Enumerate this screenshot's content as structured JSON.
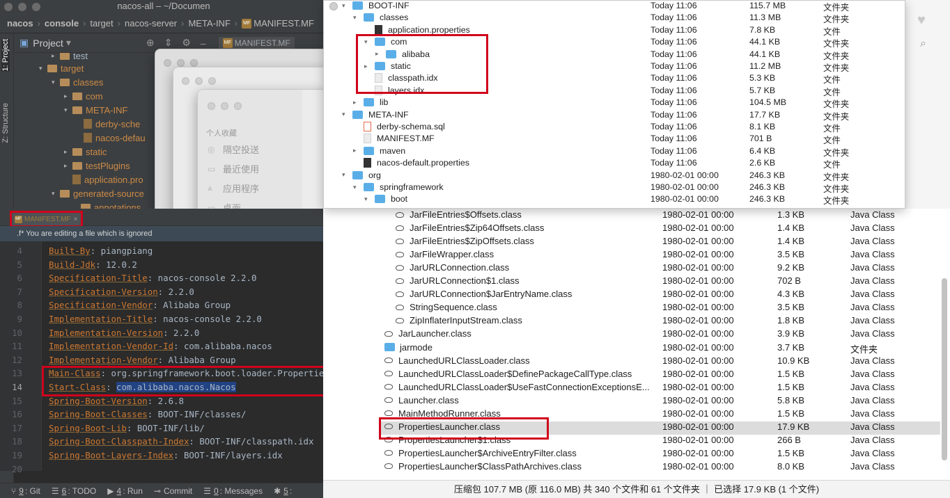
{
  "ide": {
    "window_title": "nacos-all – ~/Documen",
    "breadcrumbs": [
      "nacos",
      "console",
      "target",
      "nacos-server",
      "META-INF",
      "MANIFEST.MF"
    ],
    "breadcrumb_badge": "MF",
    "project_label": "Project",
    "top_editor_tab": "MANIFEST.MF",
    "side_tabs": [
      "1: Project",
      "Z: Structure"
    ],
    "tree": [
      {
        "label": "test",
        "indent": 3,
        "type": "folder",
        "arrow": "▸"
      },
      {
        "label": "target",
        "indent": 2,
        "type": "folder",
        "arrow": "▾"
      },
      {
        "label": "classes",
        "indent": 3,
        "type": "folder",
        "arrow": "▾"
      },
      {
        "label": "com",
        "indent": 4,
        "type": "folder",
        "arrow": "▸"
      },
      {
        "label": "META-INF",
        "indent": 4,
        "type": "folder",
        "arrow": "▾"
      },
      {
        "label": "derby-sche",
        "indent": 5,
        "type": "file",
        "arrow": ""
      },
      {
        "label": "nacos-defau",
        "indent": 5,
        "type": "file",
        "arrow": ""
      },
      {
        "label": "static",
        "indent": 4,
        "type": "folder",
        "arrow": "▸"
      },
      {
        "label": "testPlugins",
        "indent": 4,
        "type": "folder",
        "arrow": "▸"
      },
      {
        "label": "application.pro",
        "indent": 4,
        "type": "file",
        "arrow": ""
      },
      {
        "label": "generated-source",
        "indent": 3,
        "type": "folder",
        "arrow": "▾"
      },
      {
        "label": "annotations",
        "indent": 4,
        "type": "folder",
        "arrow": ""
      }
    ],
    "editor_tab": "MANIFEST.MF",
    "editor_banner": ".f* You are editing a file which is ignored",
    "code_lines": [
      {
        "n": "4",
        "key": "Built-By",
        "val": " piangpiang"
      },
      {
        "n": "5",
        "key": "Build-Jdk",
        "val": " 12.0.2"
      },
      {
        "n": "6",
        "key": "Specification-Title",
        "val": " nacos-console 2.2.0"
      },
      {
        "n": "7",
        "key": "Specification-Version",
        "val": " 2.2.0"
      },
      {
        "n": "8",
        "key": "Specification-Vendor",
        "val": " Alibaba Group"
      },
      {
        "n": "9",
        "key": "Implementation-Title",
        "val": " nacos-console 2.2.0"
      },
      {
        "n": "10",
        "key": "Implementation-Version",
        "val": " 2.2.0"
      },
      {
        "n": "11",
        "key": "Implementation-Vendor-Id",
        "val": " com.alibaba.nacos"
      },
      {
        "n": "12",
        "key": "Implementation-Vendor",
        "val": " Alibaba Group"
      },
      {
        "n": "13",
        "key": "Main-Class",
        "val": " org.springframework.boot.loader.PropertiesLauncher"
      },
      {
        "n": "14",
        "key": "Start-Class",
        "val": "com.alibaba.nacos.Nacos"
      },
      {
        "n": "15",
        "key": "Spring-Boot-Version",
        "val": " 2.6.8"
      },
      {
        "n": "16",
        "key": "Spring-Boot-Classes",
        "val": " BOOT-INF/classes/"
      },
      {
        "n": "17",
        "key": "Spring-Boot-Lib",
        "val": " BOOT-INF/lib/"
      },
      {
        "n": "18",
        "key": "Spring-Boot-Classpath-Index",
        "val": " BOOT-INF/classpath.idx"
      },
      {
        "n": "19",
        "key": "Spring-Boot-Layers-Index",
        "val": " BOOT-INF/layers.idx"
      },
      {
        "n": "20",
        "key": "",
        "val": ""
      }
    ],
    "status_items": [
      {
        "num": "9",
        "label": ": Git"
      },
      {
        "num": "6",
        "label": ": TODO"
      },
      {
        "num": "4",
        "label": ": Run"
      },
      {
        "num": "",
        "label": "Commit"
      },
      {
        "num": "0",
        "label": ": Messages"
      },
      {
        "num": "5",
        "label": ":"
      }
    ]
  },
  "ghost_finder": {
    "sidebar_heading": "个人收藏",
    "items": [
      "隔空投送",
      "最近使用",
      "应用程序",
      "桌面"
    ]
  },
  "popup": {
    "rows": [
      {
        "name": "BOOT-INF",
        "depth": 0,
        "arrow": "▾",
        "icon": "folder",
        "date": "Today 11:06",
        "size": "115.7 MB",
        "kind": "文件夹"
      },
      {
        "name": "classes",
        "depth": 1,
        "arrow": "▾",
        "icon": "folder",
        "date": "Today 11:06",
        "size": "11.3 MB",
        "kind": "文件夹"
      },
      {
        "name": "application.properties",
        "depth": 2,
        "arrow": "",
        "icon": "gear",
        "date": "Today 11:06",
        "size": "7.8 KB",
        "kind": "文件"
      },
      {
        "name": "com",
        "depth": 2,
        "arrow": "▾",
        "icon": "folder",
        "date": "Today 11:06",
        "size": "44.1 KB",
        "kind": "文件夹"
      },
      {
        "name": "alibaba",
        "depth": 3,
        "arrow": "▸",
        "icon": "folder",
        "date": "Today 11:06",
        "size": "44.1 KB",
        "kind": "文件夹"
      },
      {
        "name": "static",
        "depth": 2,
        "arrow": "▸",
        "icon": "folder",
        "date": "Today 11:06",
        "size": "11.2 MB",
        "kind": "文件夹"
      },
      {
        "name": "classpath.idx",
        "depth": 2,
        "arrow": "",
        "icon": "file",
        "date": "Today 11:06",
        "size": "5.3 KB",
        "kind": "文件"
      },
      {
        "name": "layers.idx",
        "depth": 2,
        "arrow": "",
        "icon": "file",
        "date": "Today 11:06",
        "size": "5.7 KB",
        "kind": "文件"
      },
      {
        "name": "lib",
        "depth": 1,
        "arrow": "▸",
        "icon": "folder",
        "date": "Today 11:06",
        "size": "104.5 MB",
        "kind": "文件夹"
      },
      {
        "name": "META-INF",
        "depth": 0,
        "arrow": "▾",
        "icon": "folder",
        "date": "Today 11:06",
        "size": "17.7 KB",
        "kind": "文件夹"
      },
      {
        "name": "derby-schema.sql",
        "depth": 1,
        "arrow": "",
        "icon": "db",
        "date": "Today 11:06",
        "size": "8.1 KB",
        "kind": "文件"
      },
      {
        "name": "MANIFEST.MF",
        "depth": 1,
        "arrow": "",
        "icon": "file",
        "date": "Today 11:06",
        "size": "701 B",
        "kind": "文件"
      },
      {
        "name": "maven",
        "depth": 1,
        "arrow": "▸",
        "icon": "folder",
        "date": "Today 11:06",
        "size": "6.4 KB",
        "kind": "文件夹"
      },
      {
        "name": "nacos-default.properties",
        "depth": 1,
        "arrow": "",
        "icon": "gear",
        "date": "Today 11:06",
        "size": "2.6 KB",
        "kind": "文件"
      },
      {
        "name": "org",
        "depth": 0,
        "arrow": "▾",
        "icon": "folder",
        "date": "1980-02-01 00:00",
        "size": "246.3 KB",
        "kind": "文件夹"
      },
      {
        "name": "springframework",
        "depth": 1,
        "arrow": "▾",
        "icon": "folder",
        "date": "1980-02-01 00:00",
        "size": "246.3 KB",
        "kind": "文件夹"
      },
      {
        "name": "boot",
        "depth": 2,
        "arrow": "▾",
        "icon": "folder",
        "date": "1980-02-01 00:00",
        "size": "246.3 KB",
        "kind": "文件夹"
      }
    ]
  },
  "archive": {
    "rows": [
      {
        "name": "JarFileEntries$Offsets.class",
        "depth": 1,
        "icon": "class",
        "date": "1980-02-01 00:00",
        "size": "1.3 KB",
        "kind": "Java Class"
      },
      {
        "name": "JarFileEntries$Zip64Offsets.class",
        "depth": 1,
        "icon": "class",
        "date": "1980-02-01 00:00",
        "size": "1.4 KB",
        "kind": "Java Class"
      },
      {
        "name": "JarFileEntries$ZipOffsets.class",
        "depth": 1,
        "icon": "class",
        "date": "1980-02-01 00:00",
        "size": "1.4 KB",
        "kind": "Java Class"
      },
      {
        "name": "JarFileWrapper.class",
        "depth": 1,
        "icon": "class",
        "date": "1980-02-01 00:00",
        "size": "3.5 KB",
        "kind": "Java Class"
      },
      {
        "name": "JarURLConnection.class",
        "depth": 1,
        "icon": "class",
        "date": "1980-02-01 00:00",
        "size": "9.2 KB",
        "kind": "Java Class"
      },
      {
        "name": "JarURLConnection$1.class",
        "depth": 1,
        "icon": "class",
        "date": "1980-02-01 00:00",
        "size": "702 B",
        "kind": "Java Class"
      },
      {
        "name": "JarURLConnection$JarEntryName.class",
        "depth": 1,
        "icon": "class",
        "date": "1980-02-01 00:00",
        "size": "4.3 KB",
        "kind": "Java Class"
      },
      {
        "name": "StringSequence.class",
        "depth": 1,
        "icon": "class",
        "date": "1980-02-01 00:00",
        "size": "3.5 KB",
        "kind": "Java Class"
      },
      {
        "name": "ZipInflaterInputStream.class",
        "depth": 1,
        "icon": "class",
        "date": "1980-02-01 00:00",
        "size": "1.8 KB",
        "kind": "Java Class"
      },
      {
        "name": "JarLauncher.class",
        "depth": 0,
        "icon": "class",
        "date": "1980-02-01 00:00",
        "size": "3.9 KB",
        "kind": "Java Class"
      },
      {
        "name": "jarmode",
        "depth": 0,
        "icon": "folder",
        "date": "1980-02-01 00:00",
        "size": "3.7 KB",
        "kind": "文件夹"
      },
      {
        "name": "LaunchedURLClassLoader.class",
        "depth": 0,
        "icon": "class",
        "date": "1980-02-01 00:00",
        "size": "10.9 KB",
        "kind": "Java Class"
      },
      {
        "name": "LaunchedURLClassLoader$DefinePackageCallType.class",
        "depth": 0,
        "icon": "class",
        "date": "1980-02-01 00:00",
        "size": "1.5 KB",
        "kind": "Java Class"
      },
      {
        "name": "LaunchedURLClassLoader$UseFastConnectionExceptionsE...",
        "depth": 0,
        "icon": "class",
        "date": "1980-02-01 00:00",
        "size": "1.5 KB",
        "kind": "Java Class"
      },
      {
        "name": "Launcher.class",
        "depth": 0,
        "icon": "class",
        "date": "1980-02-01 00:00",
        "size": "5.8 KB",
        "kind": "Java Class"
      },
      {
        "name": "MainMethodRunner.class",
        "depth": 0,
        "icon": "class",
        "date": "1980-02-01 00:00",
        "size": "1.5 KB",
        "kind": "Java Class"
      },
      {
        "name": "PropertiesLauncher.class",
        "depth": 0,
        "icon": "class",
        "date": "1980-02-01 00:00",
        "size": "17.9 KB",
        "kind": "Java Class",
        "selected": true
      },
      {
        "name": "PropertiesLauncher$1.class",
        "depth": 0,
        "icon": "class",
        "date": "1980-02-01 00:00",
        "size": "266 B",
        "kind": "Java Class"
      },
      {
        "name": "PropertiesLauncher$ArchiveEntryFilter.class",
        "depth": 0,
        "icon": "class",
        "date": "1980-02-01 00:00",
        "size": "1.5 KB",
        "kind": "Java Class"
      },
      {
        "name": "PropertiesLauncher$ClassPathArchives.class",
        "depth": 0,
        "icon": "class",
        "date": "1980-02-01 00:00",
        "size": "8.0 KB",
        "kind": "Java Class"
      }
    ],
    "status": "压缩包 107.7 MB (原 116.0 MB) 共 340 个文件和 61 个文件夹 ｜ 已选择 17.9 KB (1 个文件)"
  },
  "colors": {
    "highlight_box": "#d0021b",
    "folder_blue": "#5aaee8",
    "ide_bg": "#2b2b2b",
    "key_orange": "#cc7832"
  }
}
